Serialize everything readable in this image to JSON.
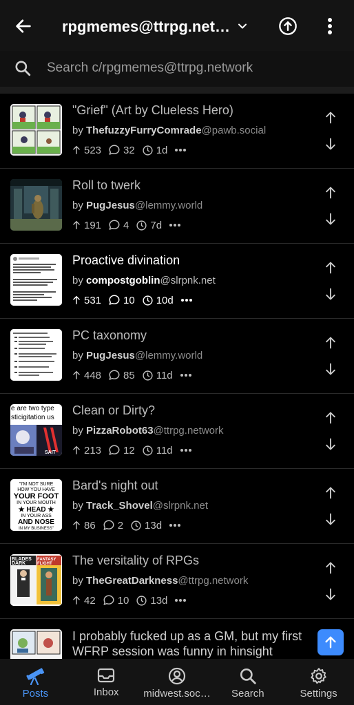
{
  "header": {
    "title": "rpgmemes@ttrpg.netw…",
    "back_icon": "arrow-left-icon",
    "dropdown_icon": "chevron-down-icon",
    "upload_icon": "arrow-up-circle-icon",
    "more_icon": "more-vertical-icon"
  },
  "search": {
    "placeholder": "Search c/rpgmemes@ttrpg.network"
  },
  "posts": [
    {
      "title": "\"Grief\" (Art by Clueless Hero)",
      "author": "ThefuzzyFurryComrade",
      "instance": "@pawb.social",
      "score": "523",
      "comments": "32",
      "age": "1d",
      "read": true
    },
    {
      "title": "Roll to twerk",
      "author": "PugJesus",
      "instance": "@lemmy.world",
      "score": "191",
      "comments": "4",
      "age": "7d",
      "read": true
    },
    {
      "title": "Proactive divination",
      "author": "compostgoblin",
      "instance": "@slrpnk.net",
      "score": "531",
      "comments": "10",
      "age": "10d",
      "read": false
    },
    {
      "title": "PC taxonomy",
      "author": "PugJesus",
      "instance": "@lemmy.world",
      "score": "448",
      "comments": "85",
      "age": "11d",
      "read": true
    },
    {
      "title": "Clean or Dirty?",
      "author": "PizzaRobot63",
      "instance": "@ttrpg.network",
      "score": "213",
      "comments": "12",
      "age": "11d",
      "read": true
    },
    {
      "title": "Bard's night out",
      "author": "Track_Shovel",
      "instance": "@slrpnk.net",
      "score": "86",
      "comments": "2",
      "age": "13d",
      "read": true
    },
    {
      "title": "The versitality of RPGs",
      "author": "TheGreatDarkness",
      "instance": "@ttrpg.network",
      "score": "42",
      "comments": "10",
      "age": "13d",
      "read": true
    }
  ],
  "partial_post": {
    "title": "I probably fucked up as a GM, but my first WFRP session was funny in hinsight"
  },
  "thumb_text": {
    "post4_lines": [
      "\"I'M NOT SURE",
      "HOW YOU HAVE",
      "YOUR FOOT",
      "IN YOUR MOUTH",
      "★ HEAD ★",
      "IN YOUR ASS",
      "AND NOSE",
      "IN MY BUSINESS\""
    ],
    "post3_top": "e are two type",
    "post3_mid": "sticigitation us",
    "post6_left": "BLADES",
    "post6_left2": "DARK",
    "post6_right": "FANTASY",
    "post6_right2": "FLIGHT",
    "post3_caption": "SAIT"
  },
  "fab_icon": "arrow-up-icon",
  "bottom_nav": [
    {
      "label": "Posts",
      "icon": "telescope-icon",
      "active": true
    },
    {
      "label": "Inbox",
      "icon": "inbox-icon",
      "active": false
    },
    {
      "label": "midwest.soc…",
      "icon": "account-icon",
      "active": false
    },
    {
      "label": "Search",
      "icon": "search-icon",
      "active": false
    },
    {
      "label": "Settings",
      "icon": "gear-icon",
      "active": false
    }
  ],
  "colors": {
    "accent": "#4a94f5",
    "fab": "#3d8bfd",
    "background": "#000000",
    "bar": "#141414"
  }
}
